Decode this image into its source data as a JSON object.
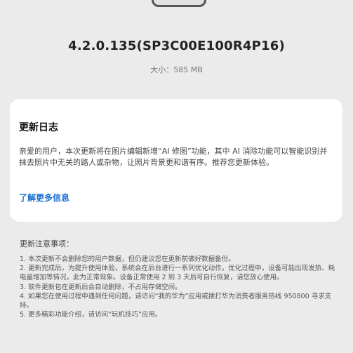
{
  "version": "4.2.0.135(SP3C00E100R4P16)",
  "size_label": "大小：585 MB",
  "changelog": {
    "title": "更新日志",
    "body": "亲爱的用户，本次更新将在图片编辑新增“AI 修图”功能，其中 AI 消除功能可以智能识别并抹去照片中无关的路人或杂物，让照片背景更和谐有序。推荐您更新体验。",
    "learn_more": "了解更多信息"
  },
  "notes": {
    "title": "更新注意事项：",
    "items": [
      "1. 本次更新不会删除您的用户数据，但仍建议您在更新前做好数据备份。",
      "2. 更新完成后，为提升使用体验，系统会在后台进行一系列优化动作，优化过程中，设备可能出现发热、耗电量增加等情况，此为正常现象。设备正常使用 2 到 3 天后可自行恢复，请您放心使用。",
      "3. 软件更新包在更新后会自动删除，不占用存储空间。",
      "4. 如果您在使用过程中遇到任何问题，请访问“我的华为”应用或拨打华为消费者服务热线 950800 寻求支持。",
      "5. 更多精彩功能介绍，请访问“玩机技巧”应用。"
    ]
  }
}
